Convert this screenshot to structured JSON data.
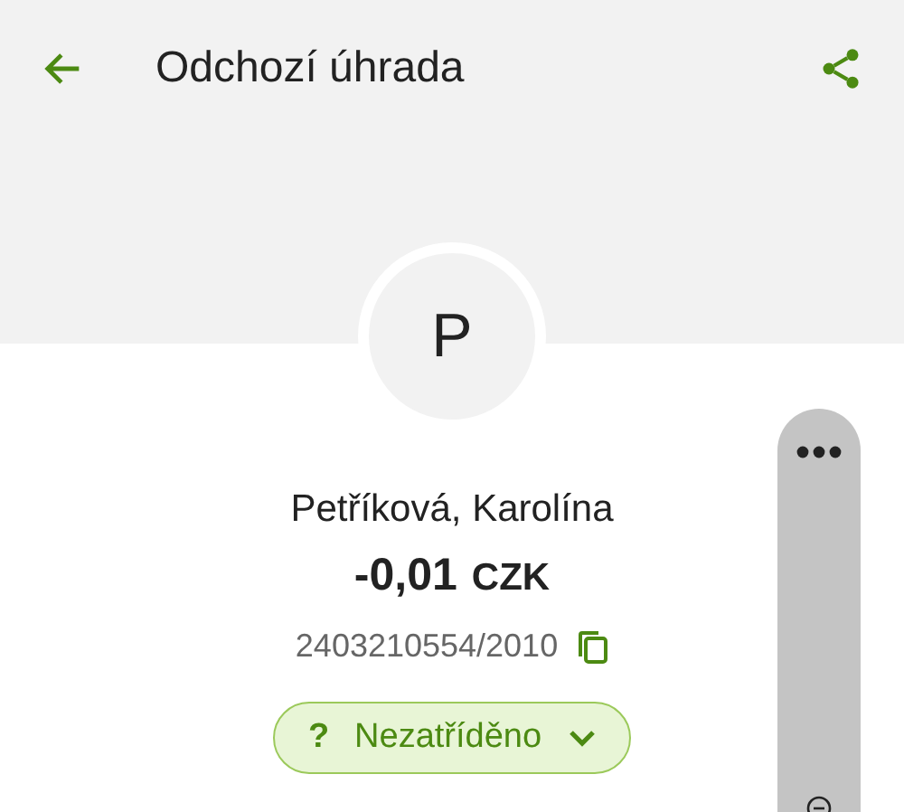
{
  "header": {
    "title": "Odchozí úhrada"
  },
  "counterparty": {
    "initial": "P",
    "name": "Petříková, Karolína",
    "amount": "-0,01",
    "currency": "CZK",
    "account": "2403210554/2010"
  },
  "category": {
    "mark": "?",
    "label": "Nezatříděno"
  }
}
